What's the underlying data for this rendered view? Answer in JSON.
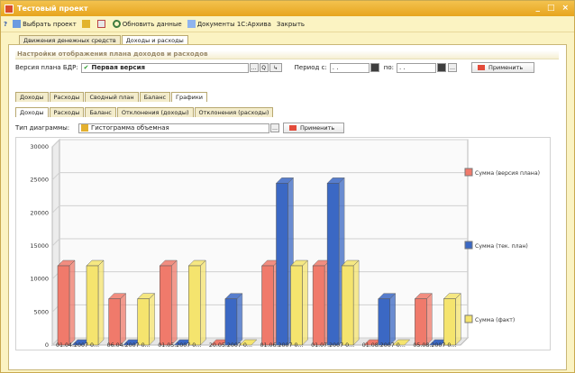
{
  "window": {
    "title": "Тестовый проект",
    "controls": [
      "_",
      "□",
      "×"
    ]
  },
  "toolbar": {
    "help": "?",
    "select_project": "Выбрать проект",
    "refresh": "Обновить данные",
    "documents": "Документы 1С:Архива",
    "close": "Закрыть"
  },
  "top_tabs": [
    "Движения денежных средств",
    "Доходы и расходы"
  ],
  "section_title": "Настройки отображения плана доходов и расходов",
  "settings": {
    "version_label": "Версия плана БДР:",
    "version_value": "Первая версия",
    "period_from_label": "Период с:",
    "period_from_value": ". .",
    "period_to_label": "по:",
    "period_to_value": ". .",
    "apply": "Применить"
  },
  "mid_tabs": [
    "Доходы",
    "Расходы",
    "Сводный план",
    "Баланс",
    "Графики"
  ],
  "inner_tabs": [
    "Доходы",
    "Расходы",
    "Баланс",
    "Отклонения (доходы)",
    "Отклонения (расходы)"
  ],
  "diagram": {
    "type_label": "Тип диаграммы:",
    "type_value": "Гистограмма объемная",
    "apply": "Применить"
  },
  "colors": {
    "plan": "#f07a6b",
    "tek": "#3b68c4",
    "fact": "#f5e46e"
  },
  "chart_data": {
    "type": "bar",
    "categories": [
      "01.04.2007 0...",
      "06.04.2007 0...",
      "01.05.2007 0...",
      "20.05.2007 0...",
      "01.06.2007 0...",
      "01.07.2007 0...",
      "01.08.2007 0...",
      "05.08.2007 0..."
    ],
    "series": [
      {
        "name": "Сумма (версия плана)",
        "values": [
          12000,
          7000,
          12000,
          0,
          12000,
          12000,
          0,
          7000
        ]
      },
      {
        "name": "Сумма (тек. план)",
        "values": [
          0,
          0,
          0,
          7000,
          24500,
          24500,
          7000,
          0
        ]
      },
      {
        "name": "Сумма (факт)",
        "values": [
          12000,
          7000,
          12000,
          0,
          12000,
          12000,
          0,
          7000
        ]
      }
    ],
    "ylim": [
      0,
      30000
    ],
    "yticks": [
      "0",
      "5000",
      "10000",
      "15000",
      "20000",
      "25000",
      "30000"
    ],
    "grid": true,
    "legend": "right"
  }
}
